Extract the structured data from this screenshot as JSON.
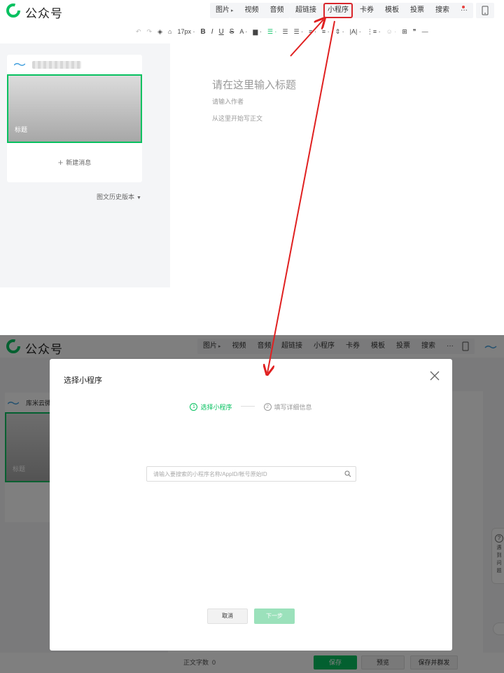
{
  "app": {
    "brand": "公众号"
  },
  "menu": {
    "group1": [
      "图片",
      "视频",
      "音频"
    ],
    "group2": [
      "超链接",
      "小程序",
      "卡券",
      "模板",
      "投票",
      "搜索",
      "···"
    ],
    "highlighted": "小程序"
  },
  "toolbar": {
    "font_size": "17px",
    "bold": "B",
    "italic": "I",
    "underline": "U",
    "strike": "S",
    "font_color": "A",
    "quote": "❞"
  },
  "left_panel": {
    "cover_title": "标题",
    "new_message": "新建消息",
    "history": "图文历史版本"
  },
  "editor": {
    "title_placeholder": "请在这里输入标题",
    "author_placeholder": "请输入作者",
    "body_placeholder": "从这里开始写正文"
  },
  "bottom": {
    "account_name": "库米云微信",
    "cover_title": "标题",
    "word_count_label": "正文字数",
    "word_count": "0",
    "save": "保存",
    "preview": "预览",
    "save_publish": "保存并群发",
    "help_text": "遇到问题"
  },
  "modal": {
    "title": "选择小程序",
    "steps": [
      {
        "num": "1",
        "label": "选择小程序"
      },
      {
        "num": "2",
        "label": "填写详细信息"
      }
    ],
    "search_placeholder": "请输入要搜索的小程序名称/AppID/帐号原始ID",
    "cancel": "取消",
    "next": "下一步"
  },
  "colors": {
    "accent": "#07c160",
    "highlight_red": "#d9262c",
    "next_disabled": "#9be1bb"
  }
}
